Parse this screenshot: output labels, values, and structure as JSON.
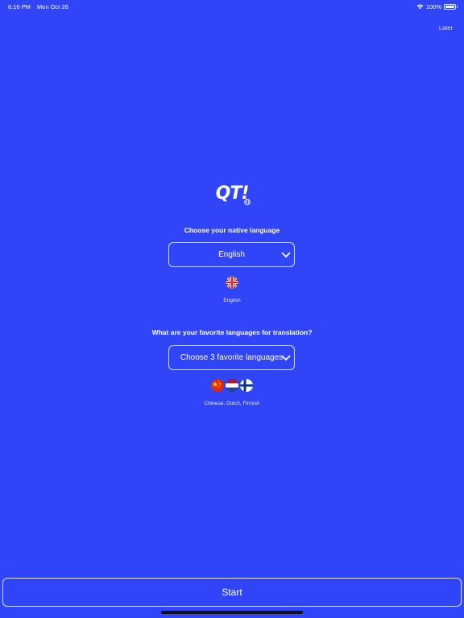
{
  "status_bar": {
    "time": "6:16 PM",
    "date": "Mon Oct 26",
    "battery": "100%"
  },
  "header": {
    "later_label": "Later"
  },
  "logo": {
    "text": "QT!"
  },
  "native": {
    "title": "Choose your native language",
    "selected": "English",
    "caption": "English"
  },
  "favorites": {
    "title": "What are your favorite languages for translation?",
    "selected": "Choose 3 favorite languages",
    "caption": "Chinese, Dutch, Finnish"
  },
  "footer": {
    "start_label": "Start"
  },
  "colors": {
    "background": "#2f45f7",
    "text": "#ffffff"
  }
}
